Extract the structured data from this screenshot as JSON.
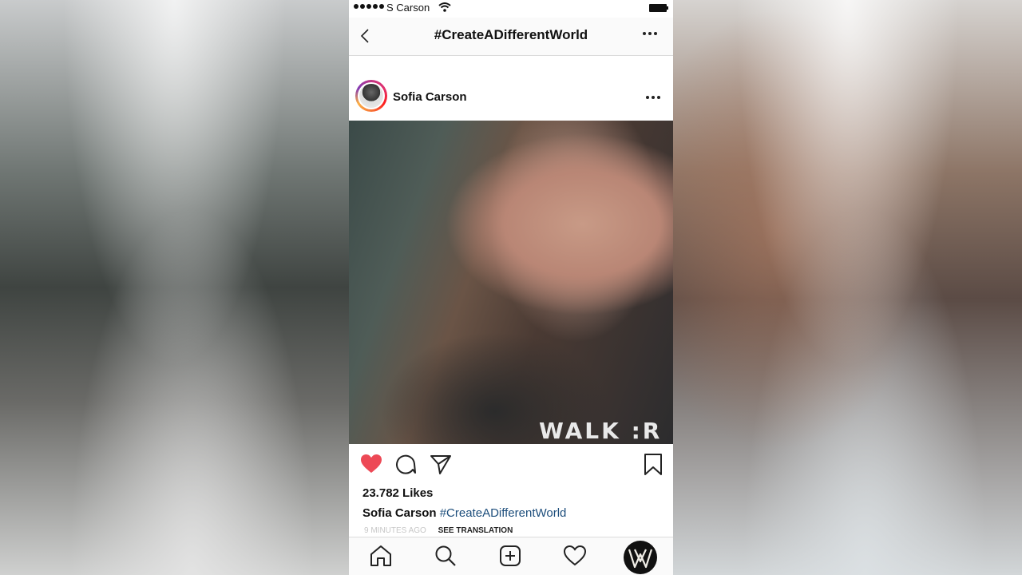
{
  "status_bar": {
    "carrier": "S Carson"
  },
  "header": {
    "title": "#CreateADifferentWorld"
  },
  "post": {
    "username": "Sofia Carson",
    "image_text": "WALK :R",
    "liked": true,
    "likes": "23.782 Likes",
    "caption_user": "Sofia Carson",
    "caption_tag": "#CreateADifferentWorld",
    "time": "9 MINUTES AGO",
    "translate_label": "SEE TRANSLATION"
  },
  "colors": {
    "heart": "#ed4956",
    "hashtag": "#1d4e7c"
  },
  "icons": {
    "header": [
      "back-icon",
      "more-icon"
    ],
    "actions": [
      "heart-icon",
      "comment-icon",
      "share-icon",
      "bookmark-icon"
    ],
    "tabs": [
      "home-icon",
      "search-icon",
      "add-icon",
      "activity-icon",
      "profile-avatar"
    ]
  }
}
